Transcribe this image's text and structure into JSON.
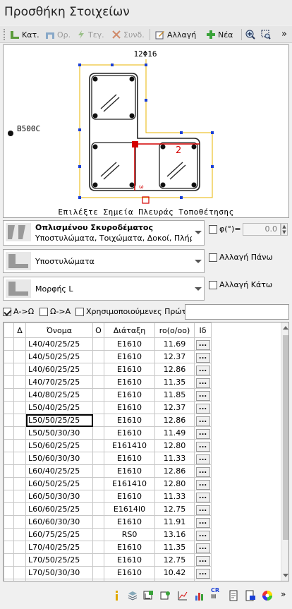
{
  "window": {
    "title": "Προσθήκη Στοιχείων"
  },
  "toolbar": {
    "kat": "Κατ.",
    "or": "Ορ.",
    "tey": "Τεγ.",
    "synd": "Συνδ.",
    "allagi": "Αλλαγή",
    "nea": "Νέα",
    "more": "»"
  },
  "drawing": {
    "top_label": "12Φ16",
    "material": "B500C",
    "side_label": "2",
    "hint": "Επιλέξτε Σημεία Πλευράς Τοποθέτησης"
  },
  "material_panel": {
    "title": "Οπλισμένου Σκυροδέματος",
    "subtitle": "Υποστυλώματα, Τοιχώματα, Δοκοί, Πλήρεις"
  },
  "category_panel": {
    "label": "Υποστυλώματα"
  },
  "shape_panel": {
    "label": "Μορφής L"
  },
  "options": {
    "phi_label": "φ(°)=",
    "phi_value": "0.0",
    "change_top": "Αλλαγή Πάνω",
    "change_bottom": "Αλλαγή Κάτω",
    "a_to_o": "Α->Ω",
    "o_to_a": "Ω->Α",
    "used_first": "Χρησιμοποιούμενες Πρώτα"
  },
  "table": {
    "headers": [
      "Δ",
      "Όνομα",
      "Ο",
      "Διάταξη",
      "ro(o/oo)",
      "Ιδ"
    ],
    "button_label": "...",
    "rows": [
      {
        "name": "L40/40/25/25",
        "layout": "E1610",
        "ro": "11.69"
      },
      {
        "name": "L40/50/25/25",
        "layout": "E1610",
        "ro": "12.37"
      },
      {
        "name": "L40/60/25/25",
        "layout": "E1610",
        "ro": "12.86"
      },
      {
        "name": "L40/70/25/25",
        "layout": "E1610",
        "ro": "11.35"
      },
      {
        "name": "L40/80/25/25",
        "layout": "E1610",
        "ro": "11.85"
      },
      {
        "name": "L50/40/25/25",
        "layout": "E1610",
        "ro": "12.37"
      },
      {
        "name": "L50/50/25/25",
        "layout": "E1610",
        "ro": "12.86"
      },
      {
        "name": "L50/50/30/30",
        "layout": "E1610",
        "ro": "11.49"
      },
      {
        "name": "L50/60/25/25",
        "layout": "E161410",
        "ro": "12.80"
      },
      {
        "name": "L50/60/30/30",
        "layout": "E1610",
        "ro": "11.33"
      },
      {
        "name": "L60/40/25/25",
        "layout": "E1610",
        "ro": "12.86"
      },
      {
        "name": "L60/50/25/25",
        "layout": "E161410",
        "ro": "12.80"
      },
      {
        "name": "L60/50/30/30",
        "layout": "E1610",
        "ro": "11.33"
      },
      {
        "name": "L60/60/25/25",
        "layout": "E1614Ι0",
        "ro": "12.75"
      },
      {
        "name": "L60/60/30/30",
        "layout": "E1610",
        "ro": "11.91"
      },
      {
        "name": "L60/75/25/25",
        "layout": "RS0",
        "ro": "13.16"
      },
      {
        "name": "L70/40/25/25",
        "layout": "E1610",
        "ro": "11.35"
      },
      {
        "name": "L70/50/25/25",
        "layout": "E1610",
        "ro": "12.75"
      },
      {
        "name": "L70/50/30/30",
        "layout": "E1610",
        "ro": "10.42"
      },
      {
        "name": "",
        "layout": "",
        "ro": ""
      }
    ]
  },
  "bottom_toolbar": {
    "cr": "CR"
  },
  "colors": {
    "accent_red": "#d40000",
    "guide_yellow": "#e8b400",
    "handle_blue": "#1a3fd6"
  }
}
